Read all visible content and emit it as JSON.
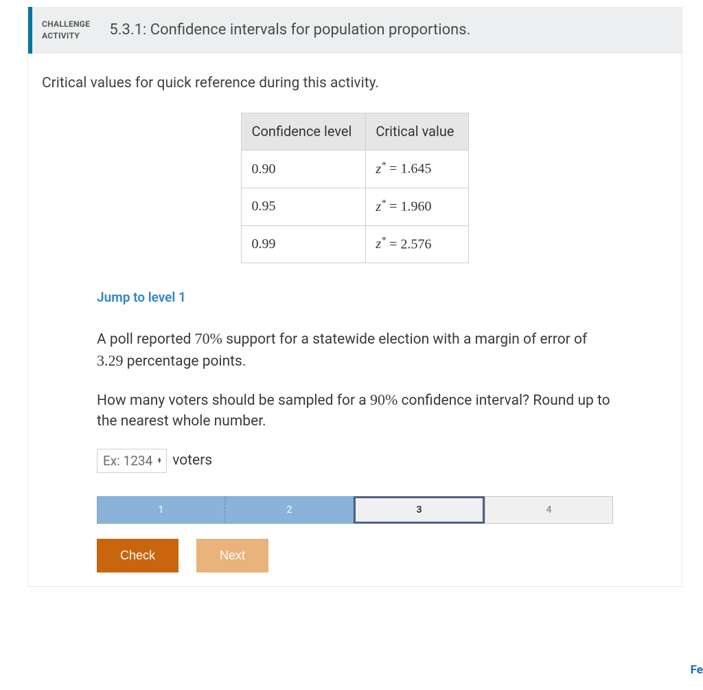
{
  "header": {
    "label_line1": "CHALLENGE",
    "label_line2": "ACTIVITY",
    "title": "5.3.1: Confidence intervals for population proportions."
  },
  "intro": "Critical values for quick reference during this activity.",
  "table": {
    "head_conf": "Confidence level",
    "head_crit": "Critical value",
    "rows": [
      {
        "conf": "0.90",
        "z": "1.645"
      },
      {
        "conf": "0.95",
        "z": "1.960"
      },
      {
        "conf": "0.99",
        "z": "2.576"
      }
    ]
  },
  "level_link": "Jump to level 1",
  "question": {
    "line1_a": "A poll reported ",
    "line1_pct": "70%",
    "line1_b": " support for a statewide election with a margin of error of ",
    "line1_moe": "3.29",
    "line1_c": " percentage points.",
    "line2_a": "How many voters should be sampled for a ",
    "line2_conf": "90%",
    "line2_b": " confidence interval? Round up to the nearest whole number."
  },
  "answer": {
    "placeholder": "Ex: 1234",
    "unit": "voters"
  },
  "progress": {
    "steps": [
      "1",
      "2",
      "3",
      "4"
    ],
    "active_index": 2,
    "completed_upto": 1
  },
  "buttons": {
    "check": "Check",
    "next": "Next"
  },
  "footer_link": "Fe"
}
